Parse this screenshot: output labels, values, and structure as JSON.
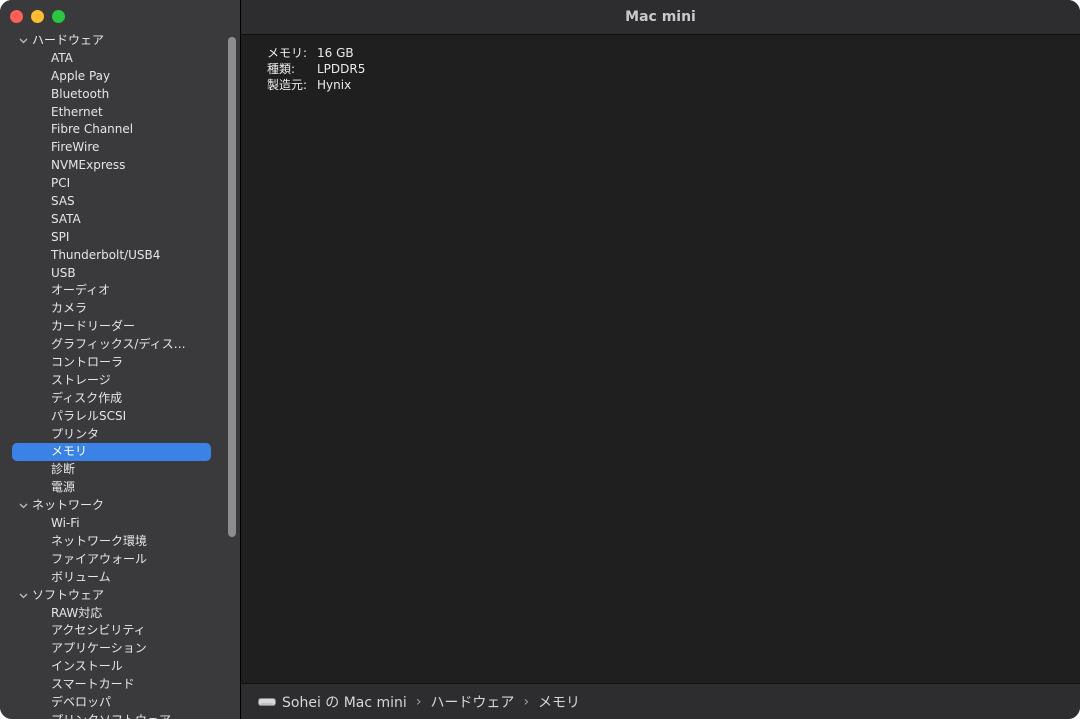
{
  "window": {
    "title": "Mac mini"
  },
  "sidebar": {
    "categories": [
      {
        "label": "ハードウェア",
        "children": [
          "ATA",
          "Apple Pay",
          "Bluetooth",
          "Ethernet",
          "Fibre Channel",
          "FireWire",
          "NVMExpress",
          "PCI",
          "SAS",
          "SATA",
          "SPI",
          "Thunderbolt/USB4",
          "USB",
          "オーディオ",
          "カメラ",
          "カードリーダー",
          "グラフィックス/ディス…",
          "コントローラ",
          "ストレージ",
          "ディスク作成",
          "パラレルSCSI",
          "プリンタ",
          "メモリ",
          "診断",
          "電源"
        ]
      },
      {
        "label": "ネットワーク",
        "children": [
          "Wi-Fi",
          "ネットワーク環境",
          "ファイアウォール",
          "ボリューム"
        ]
      },
      {
        "label": "ソフトウェア",
        "children": [
          "RAW対応",
          "アクセシビリティ",
          "アプリケーション",
          "インストール",
          "スマートカード",
          "デベロッパ",
          "プリンタソフトウェア"
        ]
      }
    ],
    "selected": "メモリ"
  },
  "details": [
    {
      "key": "メモリ:",
      "value": "16 GB"
    },
    {
      "key": "種類:",
      "value": "LPDDR5"
    },
    {
      "key": "製造元:",
      "value": "Hynix"
    }
  ],
  "breadcrumb": [
    "Sohei の Mac mini",
    "ハードウェア",
    "メモリ"
  ],
  "colors": {
    "selection": "#3b82e6",
    "sidebar_bg": "#3a3a3c",
    "content_bg": "#1f1f1f"
  }
}
